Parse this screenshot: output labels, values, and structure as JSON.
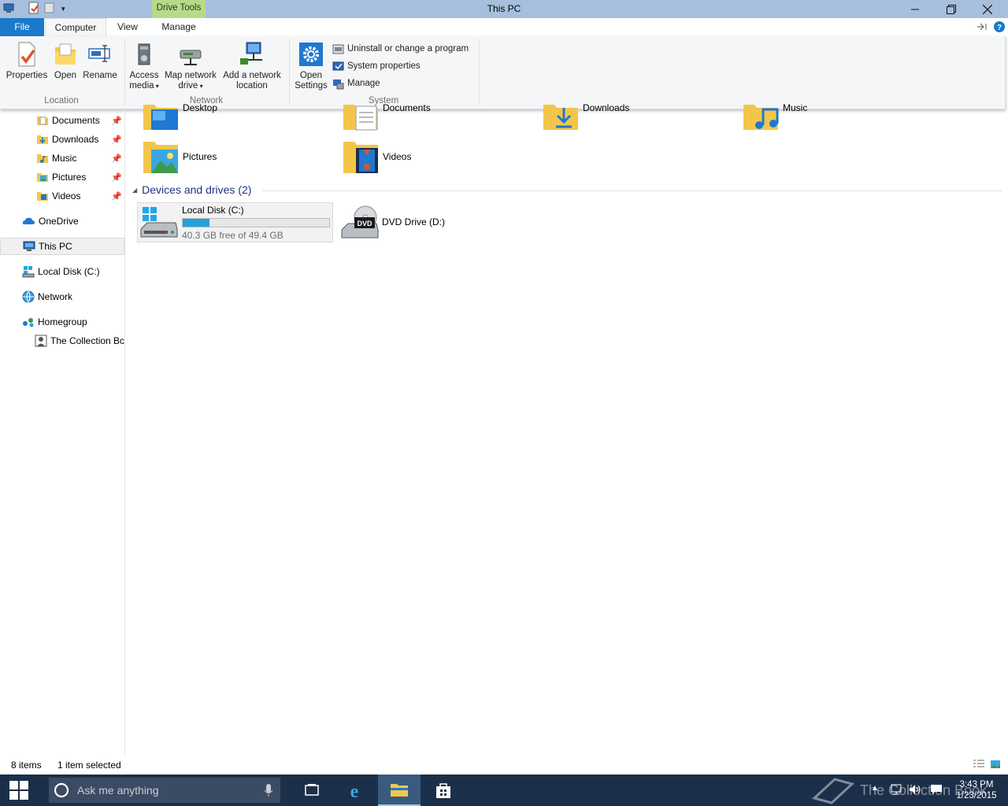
{
  "window": {
    "title": "This PC",
    "contextual_tab": "Drive Tools"
  },
  "ribbon": {
    "tabs": {
      "file": "File",
      "computer": "Computer",
      "view": "View",
      "manage": "Manage"
    },
    "location": {
      "label": "Location",
      "properties": "Properties",
      "open": "Open",
      "rename": "Rename"
    },
    "network": {
      "label": "Network",
      "access_media_line1": "Access",
      "access_media_line2": "media",
      "map_drive_line1": "Map network",
      "map_drive_line2": "drive",
      "add_location_line1": "Add a network",
      "add_location_line2": "location"
    },
    "system": {
      "label": "System",
      "open_settings_line1": "Open",
      "open_settings_line2": "Settings",
      "uninstall": "Uninstall or change a program",
      "system_properties": "System properties",
      "manage": "Manage"
    }
  },
  "nav": {
    "quick_access": [
      {
        "label": "Documents",
        "icon": "documents-folder-icon"
      },
      {
        "label": "Downloads",
        "icon": "downloads-folder-icon"
      },
      {
        "label": "Music",
        "icon": "music-folder-icon"
      },
      {
        "label": "Pictures",
        "icon": "pictures-folder-icon"
      },
      {
        "label": "Videos",
        "icon": "videos-folder-icon"
      }
    ],
    "onedrive": "OneDrive",
    "this_pc": "This PC",
    "local_disk": "Local Disk (C:)",
    "network": "Network",
    "homegroup": "Homegroup",
    "homegroup_user": "The Collection Bc"
  },
  "content": {
    "folders": [
      "Desktop",
      "Documents",
      "Downloads",
      "Music",
      "Pictures",
      "Videos"
    ],
    "devices_header": "Devices and drives (2)",
    "drive_c": {
      "name": "Local Disk (C:)",
      "free_text": "40.3 GB free of 49.4 GB",
      "used_fraction": 0.184
    },
    "drive_d": {
      "name": "DVD Drive (D:)",
      "badge": "DVD"
    }
  },
  "status": {
    "items": "8 items",
    "selected": "1 item selected"
  },
  "taskbar": {
    "search_placeholder": "Ask me anything",
    "time": "3:43 PM",
    "date": "1/23/2015",
    "watermark": "The Collection Book"
  },
  "colors": {
    "titlebar": "#a6bfdd",
    "file_tab": "#1979ca",
    "drive_tools": "#b8d98a",
    "taskbar": "#1c2f4a",
    "accent_link": "#1e3287",
    "capacity_bar": "#26a0da"
  }
}
